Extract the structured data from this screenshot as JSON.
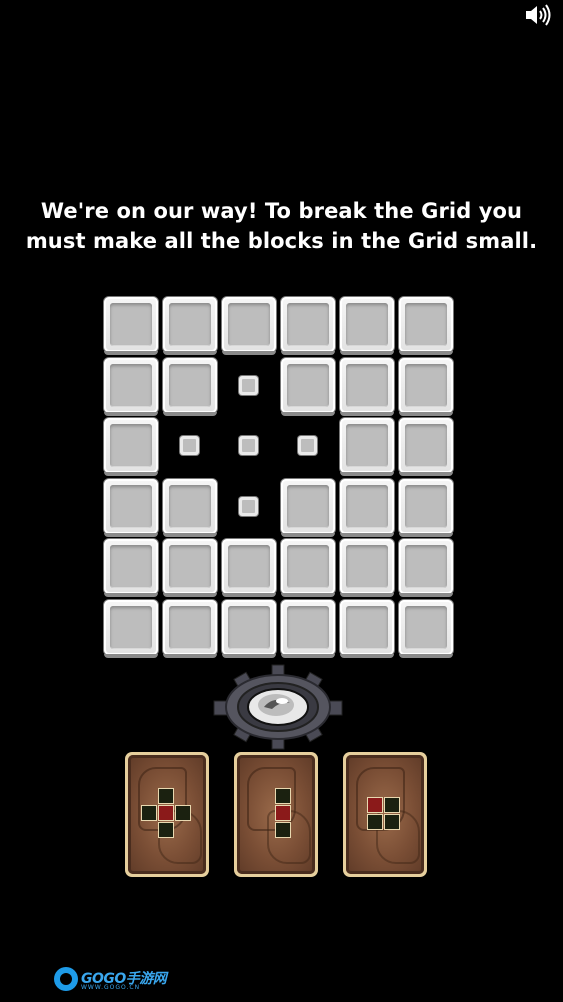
{
  "instructions": {
    "line1": "We're on our way! To break the Grid you",
    "line2": "must make all the blocks in the Grid small."
  },
  "grid": {
    "rows": 6,
    "cols": 6,
    "cells": [
      [
        "big",
        "big",
        "big",
        "big",
        "big",
        "big"
      ],
      [
        "big",
        "big",
        "small",
        "big",
        "big",
        "big"
      ],
      [
        "big",
        "small",
        "small",
        "small",
        "big",
        "big"
      ],
      [
        "big",
        "big",
        "small",
        "big",
        "big",
        "big"
      ],
      [
        "big",
        "big",
        "big",
        "big",
        "big",
        "big"
      ],
      [
        "big",
        "big",
        "big",
        "big",
        "big",
        "big"
      ]
    ]
  },
  "cards": [
    {
      "pattern": [
        [
          0,
          1,
          "dark"
        ],
        [
          1,
          0,
          "dark"
        ],
        [
          1,
          1,
          "red"
        ],
        [
          1,
          2,
          "dark"
        ],
        [
          2,
          1,
          "dark"
        ]
      ]
    },
    {
      "pattern": [
        [
          0,
          1,
          "dark"
        ],
        [
          1,
          1,
          "red"
        ],
        [
          2,
          1,
          "dark"
        ]
      ]
    },
    {
      "pattern": [
        [
          0,
          0,
          "red"
        ],
        [
          0,
          1,
          "dark"
        ],
        [
          1,
          0,
          "dark"
        ],
        [
          1,
          1,
          "dark"
        ]
      ]
    }
  ],
  "watermark": {
    "brand": "GOGO手游网",
    "url": "WWW.GOGO.CN"
  },
  "icons": {
    "sound": "sound-on-icon",
    "gear": "eye-gear-icon"
  }
}
